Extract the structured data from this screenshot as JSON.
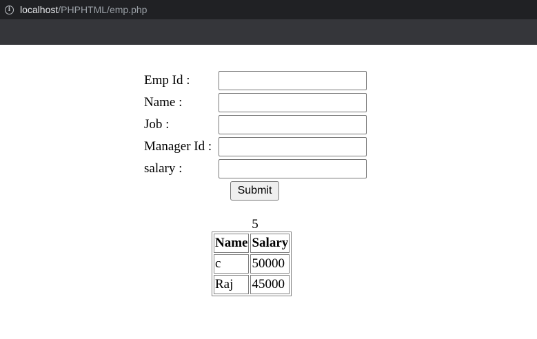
{
  "browser": {
    "url_host": "localhost",
    "url_path": "/PHPHTML/emp.php"
  },
  "form": {
    "fields": [
      {
        "label": "Emp Id :",
        "value": ""
      },
      {
        "label": "Name :",
        "value": ""
      },
      {
        "label": "Job :",
        "value": ""
      },
      {
        "label": "Manager Id :",
        "value": ""
      },
      {
        "label": "salary :",
        "value": ""
      }
    ],
    "submit_label": "Submit"
  },
  "result": {
    "count": "5",
    "headers": [
      "Name",
      "Salary"
    ],
    "rows": [
      [
        "c",
        "50000"
      ],
      [
        "Raj",
        "45000"
      ]
    ]
  }
}
